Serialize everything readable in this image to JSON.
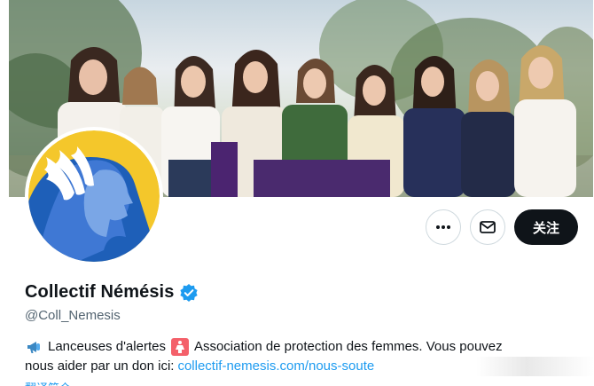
{
  "profile": {
    "display_name": "Collectif Némésis",
    "handle": "@Coll_Nemesis",
    "verified": true,
    "verified_color": "#1d9bf0"
  },
  "actions": {
    "more_icon": "more-dots-icon",
    "message_icon": "envelope-icon",
    "follow_label": "关注"
  },
  "bio": {
    "line1_text": "Lanceuses d'alertes",
    "line1_text2": "Association de protection des femmes. Vous pouvez",
    "line2_text": "nous aider par un don ici:",
    "link_text": "collectif-nemesis.com/nous-soute",
    "emoji_1": "megaphone-icon",
    "emoji_2": "womens-sign-icon"
  },
  "translate_label": "翻译简介",
  "colors": {
    "accent": "#1d9bf0",
    "text_primary": "#0f1419",
    "text_secondary": "#536471",
    "avatar_yellow": "#f4c72b",
    "avatar_blue": "#1e5fb8"
  }
}
